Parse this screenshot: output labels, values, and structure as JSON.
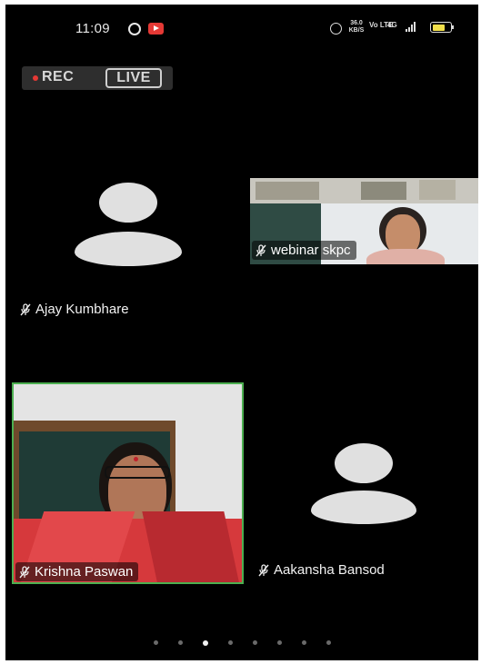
{
  "status_bar": {
    "time": "11:09",
    "speed_value": "36.0",
    "speed_unit": "KB/S",
    "network_1": "Vo LTE",
    "network_2": "4G",
    "icons": [
      "whatsapp-icon",
      "youtube-icon",
      "alarm-icon",
      "signal-icon",
      "battery-icon"
    ]
  },
  "recording": {
    "rec_label": "REC",
    "live_label": "LIVE",
    "rec_color": "#e53935"
  },
  "participants": [
    {
      "name": "Ajay Kumbhare",
      "video": false,
      "muted": true
    },
    {
      "name": "webinar skpc",
      "video": true,
      "muted": true
    },
    {
      "name": "Krishna Paswan",
      "video": true,
      "muted": true,
      "active_speaker": true
    },
    {
      "name": "Aakansha Bansod",
      "video": false,
      "muted": true
    }
  ],
  "pagination": {
    "total_pages": 8,
    "current_page": 3
  },
  "colors": {
    "active_speaker_border": "#4caf50",
    "background": "#000000"
  }
}
